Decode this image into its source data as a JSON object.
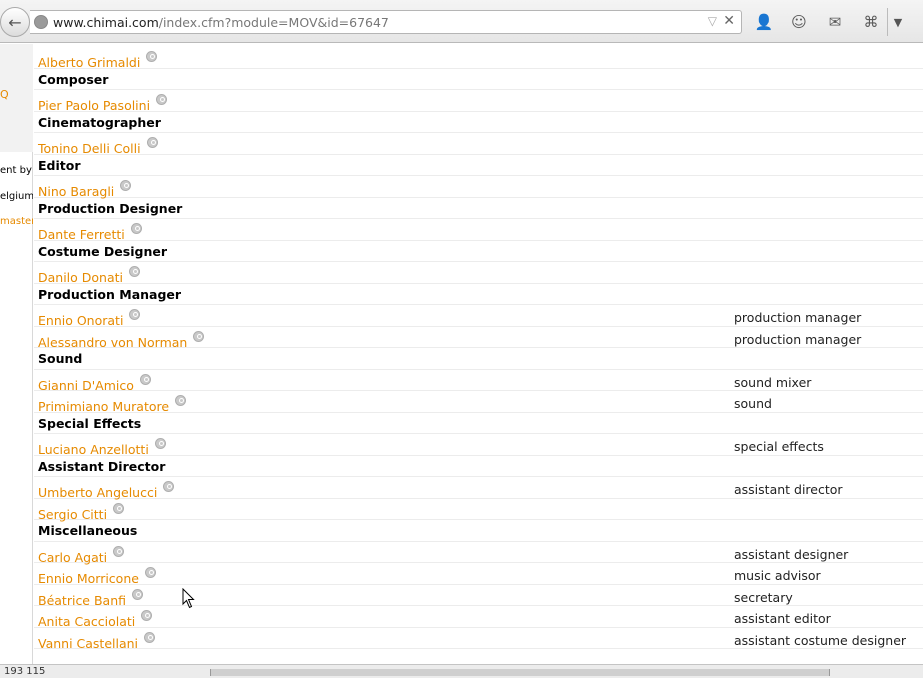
{
  "browser": {
    "url_host": "www.chimai.com",
    "url_path": "/index.cfm?module=MOV&id=67647",
    "toolbar_icons": [
      "user-icon",
      "smiley-icon",
      "chat-icon",
      "crop-icon",
      "menu-icon"
    ]
  },
  "left_pane": {
    "glyph": "Q",
    "line1": "ent by",
    "line2": "elgium.",
    "line3": "master"
  },
  "crew": [
    {
      "type": "person",
      "name": "Alberto Grimaldi",
      "role": ""
    },
    {
      "type": "dept",
      "name": "Composer"
    },
    {
      "type": "person",
      "name": "Pier Paolo Pasolini",
      "role": ""
    },
    {
      "type": "dept",
      "name": "Cinematographer"
    },
    {
      "type": "person",
      "name": "Tonino Delli Colli",
      "role": ""
    },
    {
      "type": "dept",
      "name": "Editor"
    },
    {
      "type": "person",
      "name": "Nino Baragli",
      "role": ""
    },
    {
      "type": "dept",
      "name": "Production Designer"
    },
    {
      "type": "person",
      "name": "Dante Ferretti",
      "role": ""
    },
    {
      "type": "dept",
      "name": "Costume Designer"
    },
    {
      "type": "person",
      "name": "Danilo Donati",
      "role": ""
    },
    {
      "type": "dept",
      "name": "Production Manager"
    },
    {
      "type": "person",
      "name": "Ennio Onorati",
      "role": "production manager"
    },
    {
      "type": "person",
      "name": "Alessandro von Norman",
      "role": "production manager"
    },
    {
      "type": "dept",
      "name": "Sound"
    },
    {
      "type": "person",
      "name": "Gianni D'Amico",
      "role": "sound mixer"
    },
    {
      "type": "person",
      "name": "Primimiano Muratore",
      "role": "sound"
    },
    {
      "type": "dept",
      "name": "Special Effects"
    },
    {
      "type": "person",
      "name": "Luciano Anzellotti",
      "role": "special effects"
    },
    {
      "type": "dept",
      "name": "Assistant Director"
    },
    {
      "type": "person",
      "name": "Umberto Angelucci",
      "role": "assistant director"
    },
    {
      "type": "person",
      "name": "Sergio Citti",
      "role": ""
    },
    {
      "type": "dept",
      "name": "Miscellaneous"
    },
    {
      "type": "person",
      "name": "Carlo Agati",
      "role": "assistant designer"
    },
    {
      "type": "person",
      "name": "Ennio Morricone",
      "role": "music advisor"
    },
    {
      "type": "person",
      "name": "Béatrice Banfi",
      "role": "secretary"
    },
    {
      "type": "person",
      "name": "Anita Cacciolati",
      "role": "assistant editor"
    },
    {
      "type": "person",
      "name": "Vanni Castellani",
      "role": "assistant costume designer"
    }
  ],
  "status": {
    "text": "193 115"
  },
  "colors": {
    "link": "#e68a00",
    "heading": "#000000"
  }
}
